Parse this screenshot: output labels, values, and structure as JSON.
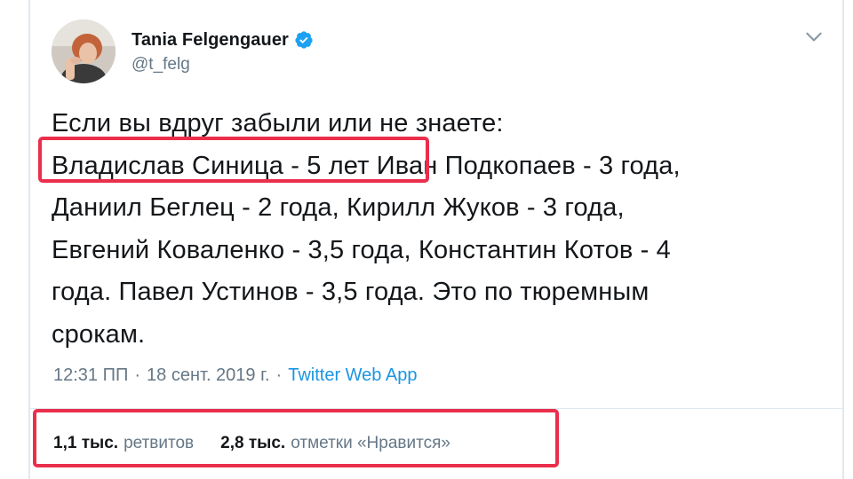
{
  "tweet": {
    "author": {
      "display_name": "Tania Felgengauer",
      "handle": "@t_felg",
      "verified_icon": "verified-badge-icon",
      "avatar_icon": "avatar"
    },
    "menu_icon": "chevron-down-icon",
    "text_lines": [
      "Если вы вдруг забыли или не знаете:",
      "Владислав Синица - 5 лет  Иван Подкопаев - 3 года,",
      "Даниил Беглец - 2 года, Кирилл Жуков - 3 года,",
      "Евгений Коваленко - 3,5 года, Константин Котов - 4",
      "года. Павел Устинов - 3,5 года. Это по тюремным",
      "срокам."
    ],
    "meta": {
      "time": "12:31 ПП",
      "separator": "·",
      "date": "18 сент. 2019 г.",
      "source": "Twitter Web App"
    },
    "stats": {
      "retweets_value": "1,1 тыс.",
      "retweets_label": "ретвитов",
      "likes_value": "2,8 тыс.",
      "likes_label": "отметки «Нравится»"
    }
  },
  "colors": {
    "text": "#14171a",
    "secondary": "#657786",
    "link": "#1b95e0",
    "verified": "#1da1f2",
    "highlight": "#ea2e4c",
    "border": "#e1e8ed"
  }
}
